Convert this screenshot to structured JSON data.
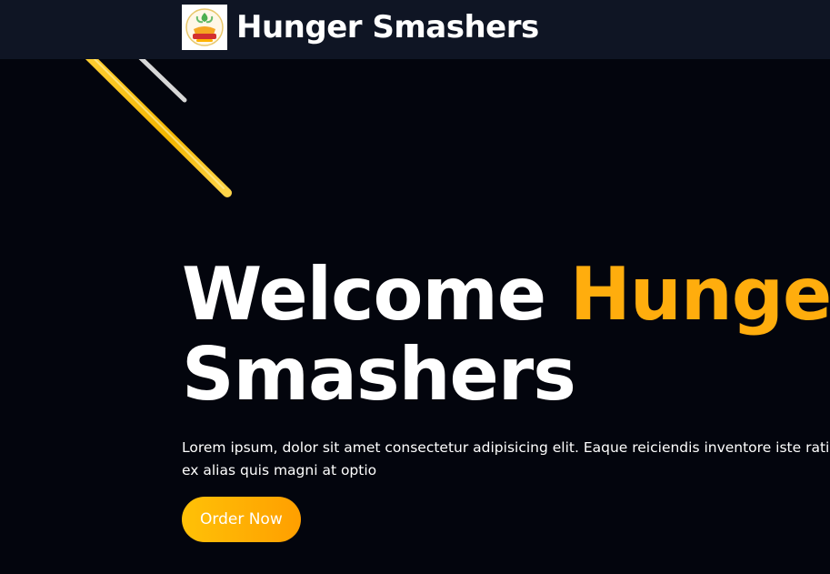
{
  "navbar": {
    "logo_icon": "restaurant-logo-icon",
    "brand": "Hunger Smashers"
  },
  "hero": {
    "title_line1_white": "Welcome ",
    "title_line1_accent": "Hunger",
    "title_line2": "Smashers",
    "description": "Lorem ipsum, dolor sit amet consectetur adipisicing elit. Eaque reiciendis inventore iste ratione ex alias quis magni at optio",
    "cta_label": "Order Now"
  },
  "colors": {
    "navbar_bg": "#0f1524",
    "hero_bg": "#03050d",
    "accent": "#ffad0d",
    "button_gradient_start": "#ffc107",
    "button_gradient_end": "#ff9f00"
  }
}
